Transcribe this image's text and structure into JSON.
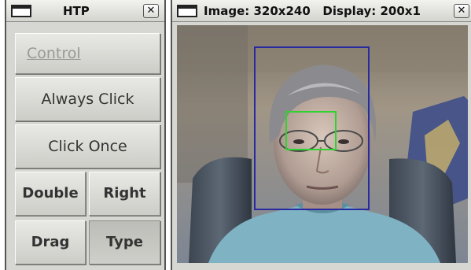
{
  "htp_window": {
    "title": "HTP",
    "close_label": "✕",
    "buttons": {
      "control": "Control",
      "always_click": "Always Click",
      "click_once": "Click Once",
      "double": "Double",
      "right": "Right",
      "drag": "Drag",
      "type": "Type"
    }
  },
  "image_window": {
    "title": "Image: 320x240   Display: 200x1",
    "close_label": "✕",
    "face_box_color": "#2a2aa0",
    "eye_box_color": "#2fd22f"
  },
  "colors": {
    "button_face": "#d6d6d2",
    "titlebar": "#e4e4e0"
  }
}
